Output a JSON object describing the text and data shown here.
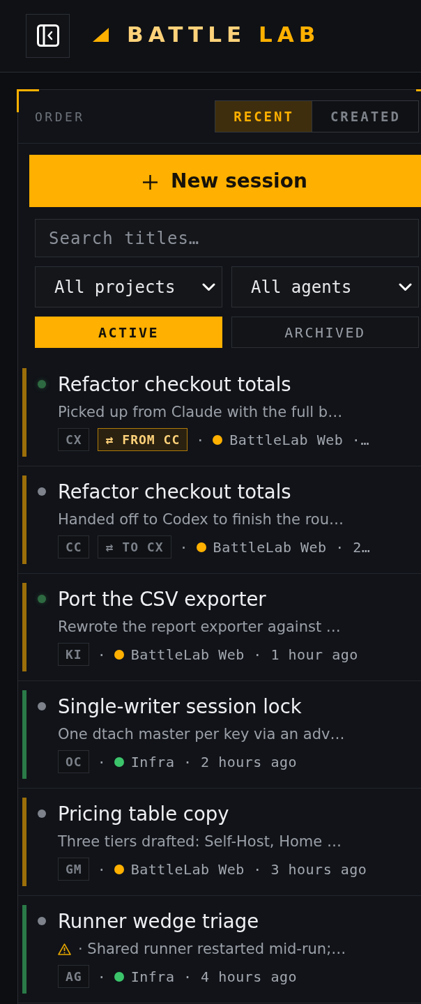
{
  "brand": {
    "title": "BATTLE",
    "accent": "LAB"
  },
  "order": {
    "label": "ORDER",
    "options": [
      {
        "label": "RECENT",
        "selected": true
      },
      {
        "label": "CREATED",
        "selected": false
      }
    ]
  },
  "new_session_button": {
    "label": "New session"
  },
  "search": {
    "placeholder": "Search titles…"
  },
  "filters": [
    {
      "value": "All projects"
    },
    {
      "value": "All agents"
    }
  ],
  "status_tabs": [
    {
      "label": "ACTIVE",
      "selected": true
    },
    {
      "label": "ARCHIVED",
      "selected": false
    }
  ],
  "sessions": [
    {
      "title": "Refactor checkout totals",
      "running": true,
      "warning": false,
      "summary": "Picked up from Claude with the full b…",
      "agent": "CX",
      "handoff": {
        "text": "⇄ FROM CC",
        "kind": "from"
      },
      "separator": "·",
      "color": "#ffb000",
      "details": "BattleLab Web ·…"
    },
    {
      "title": "Refactor checkout totals",
      "running": false,
      "warning": false,
      "summary": "Handed off to Codex to finish the rou…",
      "agent": "CC",
      "handoff": {
        "text": "⇄ TO CX",
        "kind": "to"
      },
      "separator": "·",
      "color": "#ffb000",
      "details": "BattleLab Web · 2…"
    },
    {
      "title": "Port the CSV exporter",
      "running": true,
      "warning": false,
      "summary": "Rewrote the report exporter against …",
      "agent": "KI",
      "separator": "·",
      "color": "#ffb000",
      "details": "BattleLab Web · 1 hour ago"
    },
    {
      "title": "Single-writer session lock",
      "running": false,
      "warning": false,
      "summary": "One dtach master per key via an adv…",
      "agent": "OC",
      "separator": "·",
      "color": "#3cc46b",
      "details": "Infra · 2 hours ago"
    },
    {
      "title": "Pricing table copy",
      "running": false,
      "warning": false,
      "summary": "Three tiers drafted: Self-Host, Home …",
      "agent": "GM",
      "separator": "·",
      "color": "#ffb000",
      "details": "BattleLab Web · 3 hours ago"
    },
    {
      "title": "Runner wedge triage",
      "running": false,
      "warning": true,
      "summary": "· Shared runner restarted mid-run;…",
      "agent": "AG",
      "separator": "·",
      "color": "#3cc46b",
      "details": "Infra · 4 hours ago"
    }
  ]
}
